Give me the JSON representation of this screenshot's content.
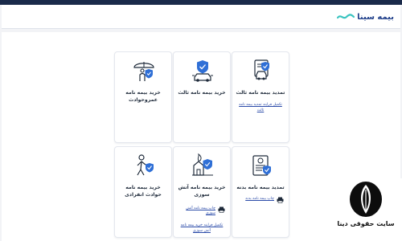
{
  "header": {
    "logo_text": "بیمه سینا"
  },
  "cards": [
    {
      "title": "تمدید بیمه نامه ثالث",
      "icon": "car-document-icon",
      "link": "تکمیل فرایند تمدید بیمه نامه ثالث"
    },
    {
      "title": "خرید بیمه نامه ثالث",
      "icon": "car-shield-icon"
    },
    {
      "title": "خرید بیمه نامه عمروحوادث",
      "icon": "umbrella-person-icon"
    },
    {
      "title": "تمدید بیمه نامه بدنه",
      "icon": "document-shield-icon",
      "download": "چاپ بیمه نامه بدنه"
    },
    {
      "title": "خرید بیمه نامه آتش سوزی",
      "icon": "fire-shield-icon",
      "download": "چاپ بیمه نامه آتش سوزی",
      "link": "تکمیل فرایند خرید بیمه نامه آتش سوزی"
    },
    {
      "title": "خرید بیمه نامه حوادث انفرادی",
      "icon": "person-shield-icon"
    }
  ],
  "watermark": {
    "name": "سایت حقوقی دینا"
  },
  "colors": {
    "accent": "#1f3f8a",
    "shield": "#2f6fd6",
    "link": "#2a4aa8",
    "topbar": "#1a2a4a"
  }
}
